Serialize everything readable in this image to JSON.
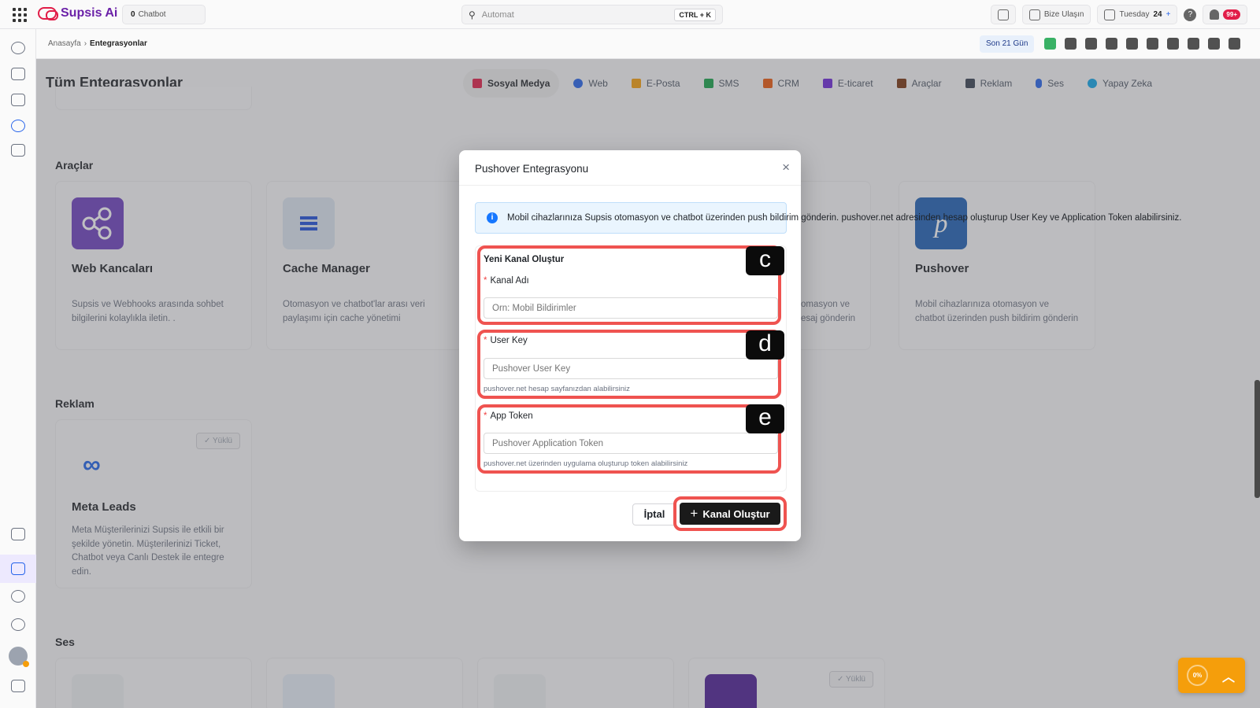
{
  "topbar": {
    "logo_text": "Supsis Ai",
    "chatbot_count": "0",
    "chatbot_label": "Chatbot",
    "search_placeholder": "Automat",
    "search_shortcut": "CTRL + K",
    "contact_label": "Bize Ulaşın",
    "date_day": "Tuesday",
    "date_num": "24",
    "notif_badge": "99+"
  },
  "subheader": {
    "breadcrumb_home": "Anasayfa",
    "breadcrumb_sep": "›",
    "breadcrumb_current": "Entegrasyonlar",
    "range_label": "Son 21 Gün"
  },
  "page": {
    "title": "Tüm Entegrasyonlar",
    "tabs": [
      {
        "label": "Sosyal Medya",
        "icon": "share-icon",
        "color": "#e11d48"
      },
      {
        "label": "Web",
        "icon": "globe-icon",
        "color": "#2563eb"
      },
      {
        "label": "E-Posta",
        "icon": "mail-icon",
        "color": "#f59e0b"
      },
      {
        "label": "SMS",
        "icon": "message-icon",
        "color": "#16a34a"
      },
      {
        "label": "CRM",
        "icon": "users-icon",
        "color": "#ea580c"
      },
      {
        "label": "E-ticaret",
        "icon": "cart-icon",
        "color": "#6d28d9"
      },
      {
        "label": "Araçlar",
        "icon": "wrench-icon",
        "color": "#78350f"
      },
      {
        "label": "Reklam",
        "icon": "megaphone-icon",
        "color": "#374151"
      },
      {
        "label": "Ses",
        "icon": "mic-icon",
        "color": "#2563eb"
      },
      {
        "label": "Yapay Zeka",
        "icon": "ai-icon",
        "color": "#0ea5e9"
      }
    ]
  },
  "sections": {
    "tools": {
      "title": "Araçlar",
      "cards": [
        {
          "title": "Web Kancaları",
          "desc": "Supsis ve Webhooks arasında sohbet bilgilerini kolaylıkla iletin. .",
          "icon": "share-nodes-icon",
          "color": "#6d3fbf"
        },
        {
          "title": "Cache Manager",
          "desc": "Otomasyon ve chatbot'lar arası veri paylaşımı için cache yönetimi",
          "icon": "list-icon",
          "color": "#dbe5f1"
        },
        {
          "title": "",
          "desc": "omasyon ve esaj gönderin",
          "icon": "",
          "color": ""
        },
        {
          "title": "Pushover",
          "desc": "Mobil cihazlarınıza otomasyon ve chatbot üzerinden push bildirim gönderin",
          "icon": "pushover-icon",
          "color": "#1d5fb5"
        }
      ]
    },
    "ads": {
      "title": "Reklam",
      "cards": [
        {
          "title": "Meta Leads",
          "desc": "Meta Müşterilerinizi Supsis ile etkili bir şekilde yönetin. Müşterilerinizi Ticket, Chatbot veya Canlı Destek ile entegre edin.",
          "badge": "✓ Yüklü"
        }
      ]
    },
    "voice": {
      "title": "Ses",
      "installed_badge": "✓ Yüklü"
    }
  },
  "modal": {
    "title": "Pushover Entegrasyonu",
    "close_label": "×",
    "info_text": "Mobil cihazlarınıza Supsis otomasyon ve chatbot üzerinden push bildirim gönderin. pushover.net adresinden hesap oluşturup User Key ve Application Token alabilirsiniz.",
    "section_label": "Yeni Kanal Oluştur",
    "fields": {
      "channel_name": {
        "label": "Kanal Adı",
        "placeholder": "Örn: Mobil Bildirimler"
      },
      "user_key": {
        "label": "User Key",
        "placeholder": "Pushover User Key",
        "hint": "pushover.net hesap sayfanızdan alabilirsiniz"
      },
      "app_token": {
        "label": "App Token",
        "placeholder": "Pushover Application Token",
        "hint": "pushover.net üzerinden uygulama oluşturup token alabilirsiniz"
      }
    },
    "required_mark": "*",
    "annotations": [
      "c",
      "d",
      "e"
    ],
    "cancel_label": "İptal",
    "create_label": "Kanal Oluştur",
    "create_icon": "+"
  },
  "widget": {
    "progress_text": "0%",
    "chevron": "︿"
  }
}
